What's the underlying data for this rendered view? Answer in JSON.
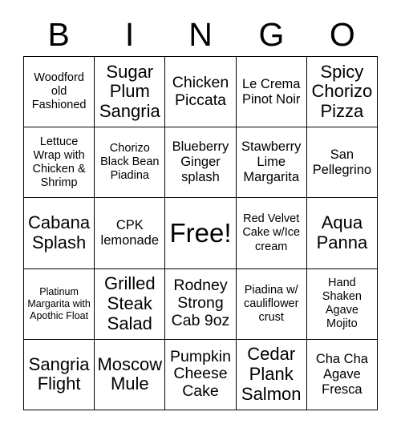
{
  "card": {
    "header": {
      "letters": [
        "B",
        "I",
        "N",
        "G",
        "O"
      ]
    },
    "grid": {
      "rows": 5,
      "columns": 5,
      "free_space_index": 12,
      "border_color": "#000000",
      "cell_background": "#ffffff",
      "cells": [
        {
          "text": "Woodford old Fashioned",
          "size": "s"
        },
        {
          "text": "Sugar Plum Sangria",
          "size": "xl"
        },
        {
          "text": "Chicken Piccata",
          "size": "l"
        },
        {
          "text": "Le Crema Pinot Noir",
          "size": "m"
        },
        {
          "text": "Spicy Chorizo Pizza",
          "size": "xl"
        },
        {
          "text": "Lettuce Wrap with Chicken & Shrimp",
          "size": "s"
        },
        {
          "text": "Chorizo Black Bean Piadina",
          "size": "s"
        },
        {
          "text": "Blueberry Ginger splash",
          "size": "m"
        },
        {
          "text": "Stawberry Lime Margarita",
          "size": "m"
        },
        {
          "text": "San Pellegrino",
          "size": "m"
        },
        {
          "text": "Cabana Splash",
          "size": "xl"
        },
        {
          "text": "CPK lemonade",
          "size": "m"
        },
        {
          "text": "Free!",
          "size": "free"
        },
        {
          "text": "Red Velvet Cake w/Ice cream",
          "size": "s"
        },
        {
          "text": "Aqua Panna",
          "size": "xl"
        },
        {
          "text": "Platinum Margarita with Apothic Float",
          "size": "xs"
        },
        {
          "text": "Grilled Steak Salad",
          "size": "xl"
        },
        {
          "text": "Rodney Strong Cab 9oz",
          "size": "l"
        },
        {
          "text": "Piadina w/ cauliflower crust",
          "size": "s"
        },
        {
          "text": "Hand Shaken Agave Mojito",
          "size": "s"
        },
        {
          "text": "Sangria Flight",
          "size": "xl"
        },
        {
          "text": "Moscow Mule",
          "size": "xl"
        },
        {
          "text": "Pumpkin Cheese Cake",
          "size": "l"
        },
        {
          "text": "Cedar Plank Salmon",
          "size": "xl"
        },
        {
          "text": "Cha Cha Agave Fresca",
          "size": "m"
        }
      ]
    }
  }
}
